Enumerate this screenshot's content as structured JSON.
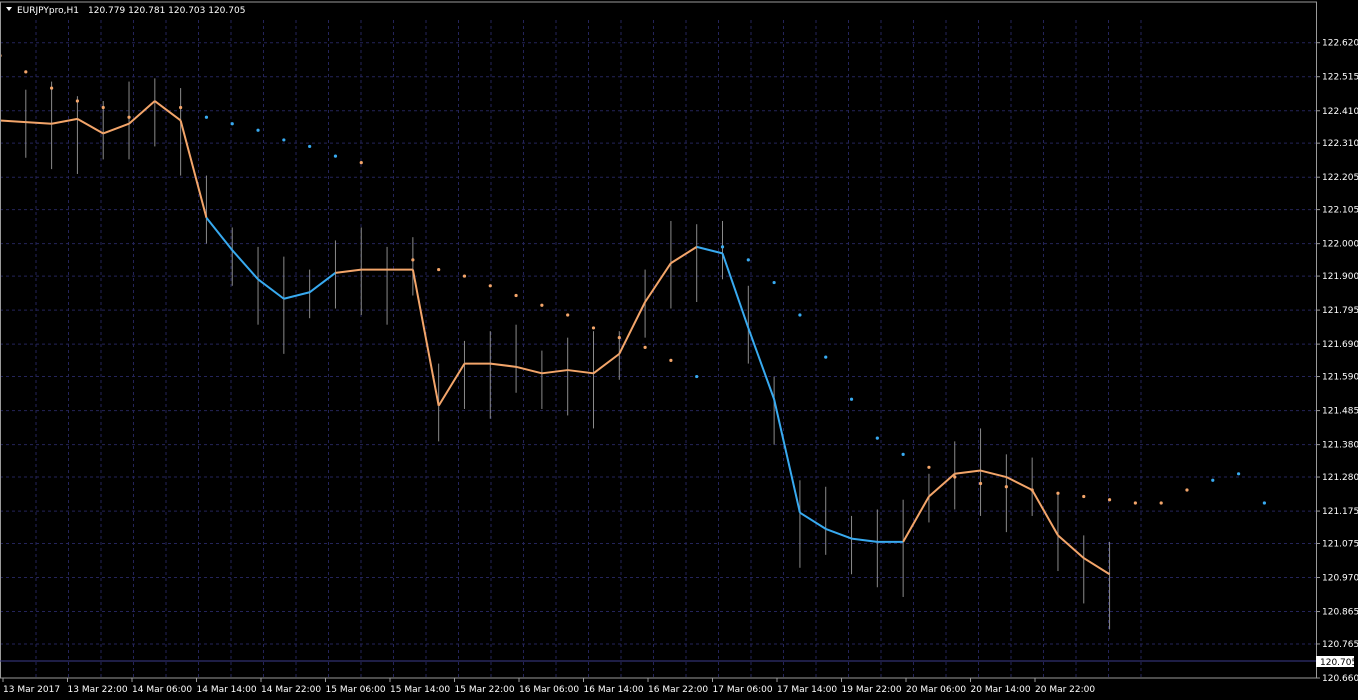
{
  "chart_window": {
    "symbol": "EURJPYpro,H1",
    "ohlc": "120.779 120.781 120.703 120.705",
    "current_price": "120.705"
  },
  "chart_data": {
    "type": "line",
    "title": "EURJPYpro,H1",
    "ylim": [
      120.66,
      122.69
    ],
    "grid": true,
    "y_ticks": [
      "122.620",
      "122.515",
      "122.410",
      "122.310",
      "122.205",
      "122.105",
      "122.000",
      "121.900",
      "121.795",
      "121.690",
      "121.590",
      "121.485",
      "121.380",
      "121.280",
      "121.175",
      "121.075",
      "120.970",
      "120.865",
      "120.765",
      "120.660"
    ],
    "x_ticks": [
      "13 Mar 2017",
      "13 Mar 22:00",
      "14 Mar 06:00",
      "14 Mar 14:00",
      "14 Mar 22:00",
      "15 Mar 06:00",
      "15 Mar 14:00",
      "15 Mar 22:00",
      "16 Mar 06:00",
      "16 Mar 14:00",
      "16 Mar 22:00",
      "17 Mar 06:00",
      "17 Mar 14:00",
      "19 Mar 22:00",
      "20 Mar 06:00",
      "20 Mar 14:00",
      "20 Mar 22:00"
    ],
    "x_range": [
      0,
      102
    ],
    "series": [
      {
        "color_up": "#38aaf0",
        "color_down": "#f3a56a",
        "x": [
          0,
          2,
          4,
          6,
          8,
          10,
          12,
          14,
          16,
          18,
          20,
          22,
          24,
          26,
          28,
          30,
          32,
          34,
          36,
          38,
          40,
          42,
          44,
          46,
          48,
          50,
          52,
          54,
          56,
          58,
          60,
          62,
          64,
          66,
          68,
          70,
          72,
          74,
          76,
          78,
          80,
          82,
          84,
          86,
          88,
          90,
          92,
          94,
          96,
          98,
          100
        ],
        "y": [
          122.38,
          122.375,
          122.37,
          122.385,
          122.34,
          122.37,
          122.44,
          122.38,
          122.08,
          121.98,
          121.89,
          121.83,
          121.85,
          121.91,
          121.92,
          121.92,
          121.92,
          121.5,
          121.63,
          121.63,
          121.62,
          121.6,
          121.61,
          121.6,
          121.66,
          121.82,
          121.94,
          121.99,
          121.97,
          121.74,
          121.52,
          121.17,
          121.12,
          121.09,
          121.08,
          121.08,
          121.22,
          121.29,
          121.3,
          121.28,
          121.24,
          121.1,
          121.03,
          120.98,
          null,
          null,
          null,
          null,
          null,
          null,
          null
        ],
        "up_ranges": [
          [
            8,
            13
          ],
          [
            27,
            35
          ],
          [
            47,
            57
          ],
          [
            67,
            75
          ]
        ]
      },
      {
        "dots_upper_x": [
          0,
          2,
          4,
          6,
          8,
          10,
          14,
          16,
          18,
          20,
          22,
          24,
          26,
          28,
          32,
          34,
          36,
          38,
          40,
          42,
          44,
          46,
          48,
          50,
          52,
          54,
          56,
          58,
          60,
          62,
          64,
          66,
          68,
          70,
          72,
          74,
          76,
          78,
          80,
          82,
          84,
          86,
          88,
          90,
          92,
          94,
          96,
          98
        ],
        "dots_upper_y": [
          122.58,
          122.53,
          122.48,
          122.44,
          122.42,
          122.39,
          122.42,
          122.39,
          122.37,
          122.35,
          122.32,
          122.3,
          122.27,
          122.25,
          121.95,
          121.92,
          121.9,
          121.87,
          121.84,
          121.81,
          121.78,
          121.74,
          121.71,
          121.68,
          121.64,
          121.59,
          121.99,
          121.95,
          121.88,
          121.78,
          121.65,
          121.52,
          121.4,
          121.35,
          121.31,
          121.28,
          121.26,
          121.25,
          121.24,
          121.23,
          121.22,
          121.21,
          121.2,
          121.2,
          121.24,
          121.27,
          121.29,
          121.2
        ]
      }
    ]
  }
}
